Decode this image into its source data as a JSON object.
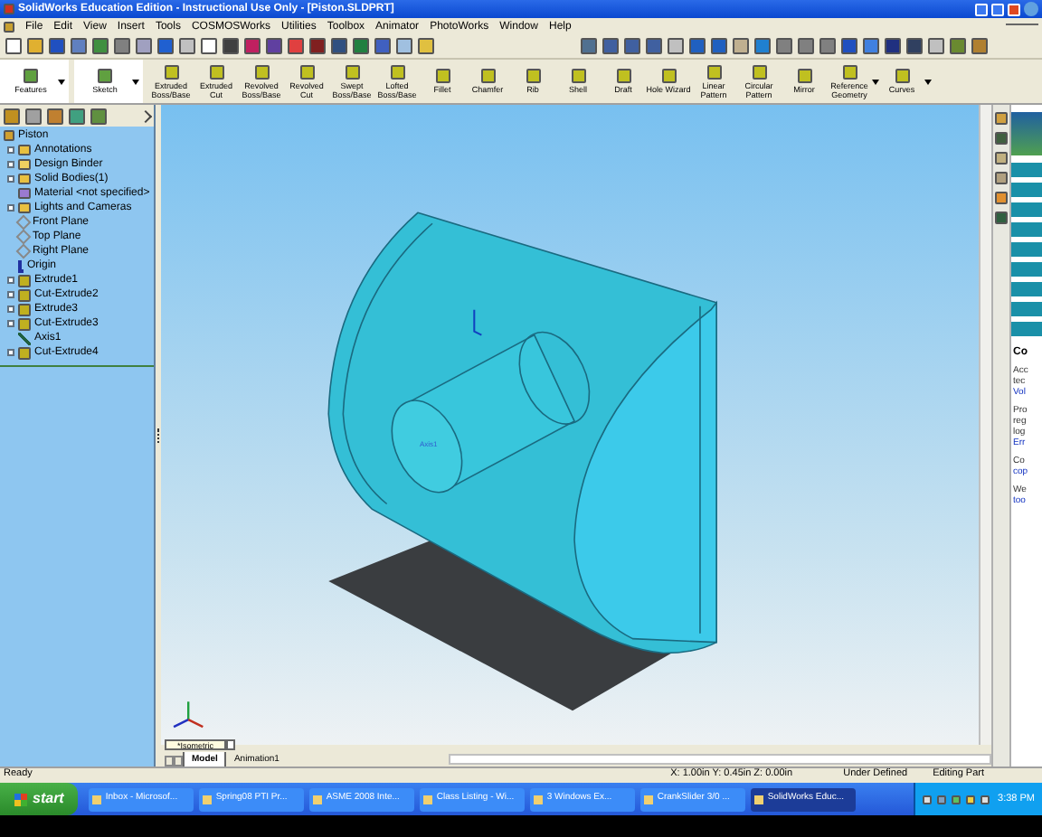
{
  "window": {
    "title": "SolidWorks Education Edition - Instructional Use Only - [Piston.SLDPRT]"
  },
  "menu": [
    "File",
    "Edit",
    "View",
    "Insert",
    "Tools",
    "COSMOSWorks",
    "Utilities",
    "Toolbox",
    "Animator",
    "PhotoWorks",
    "Window",
    "Help"
  ],
  "feature_tools": [
    {
      "label": "Features",
      "kind": "tab",
      "dropdown": true
    },
    {
      "label": "Sketch",
      "kind": "tab",
      "dropdown": true
    },
    {
      "label": "Extruded Boss/Base",
      "kind": "tool",
      "dropdown": false
    },
    {
      "label": "Extruded Cut",
      "kind": "tool",
      "dropdown": false
    },
    {
      "label": "Revolved Boss/Base",
      "kind": "tool",
      "dropdown": false
    },
    {
      "label": "Revolved Cut",
      "kind": "tool",
      "dropdown": false
    },
    {
      "label": "Swept Boss/Base",
      "kind": "tool",
      "dropdown": false
    },
    {
      "label": "Lofted Boss/Base",
      "kind": "tool",
      "dropdown": false
    },
    {
      "label": "Fillet",
      "kind": "tool",
      "dropdown": false
    },
    {
      "label": "Chamfer",
      "kind": "tool",
      "dropdown": false
    },
    {
      "label": "Rib",
      "kind": "tool",
      "dropdown": false
    },
    {
      "label": "Shell",
      "kind": "tool",
      "dropdown": false
    },
    {
      "label": "Draft",
      "kind": "tool",
      "dropdown": false
    },
    {
      "label": "Hole Wizard",
      "kind": "tool",
      "dropdown": false
    },
    {
      "label": "Linear Pattern",
      "kind": "tool",
      "dropdown": false
    },
    {
      "label": "Circular Pattern",
      "kind": "tool",
      "dropdown": false
    },
    {
      "label": "Mirror",
      "kind": "tool",
      "dropdown": false
    },
    {
      "label": "Reference Geometry",
      "kind": "tool",
      "dropdown": true
    },
    {
      "label": "Curves",
      "kind": "tool",
      "dropdown": true
    }
  ],
  "feature_tree": {
    "label": "Piston",
    "children": [
      {
        "label": "Annotations",
        "kind": "folder",
        "expandable": true
      },
      {
        "label": "Design Binder",
        "kind": "binder",
        "expandable": true
      },
      {
        "label": "Solid Bodies(1)",
        "kind": "folder",
        "expandable": true
      },
      {
        "label": "Material <not specified>",
        "kind": "material",
        "expandable": false
      },
      {
        "label": "Lights and Cameras",
        "kind": "folder",
        "expandable": true
      },
      {
        "label": "Front Plane",
        "kind": "plane",
        "expandable": false
      },
      {
        "label": "Top Plane",
        "kind": "plane",
        "expandable": false
      },
      {
        "label": "Right Plane",
        "kind": "plane",
        "expandable": false
      },
      {
        "label": "Origin",
        "kind": "origin",
        "expandable": false
      },
      {
        "label": "Extrude1",
        "kind": "feature",
        "expandable": true
      },
      {
        "label": "Cut-Extrude2",
        "kind": "feature",
        "expandable": true
      },
      {
        "label": "Extrude3",
        "kind": "feature",
        "expandable": true
      },
      {
        "label": "Cut-Extrude3",
        "kind": "feature",
        "expandable": true
      },
      {
        "label": "Axis1",
        "kind": "axis",
        "expandable": false
      },
      {
        "label": "Cut-Extrude4",
        "kind": "feature",
        "expandable": true
      }
    ]
  },
  "viewport": {
    "axis_label": "Axis1",
    "view": "*Isometric"
  },
  "view_tabs": [
    {
      "label": "Model",
      "selected": true
    },
    {
      "label": "Animation1",
      "selected": false
    }
  ],
  "task_pane": {
    "heading": "Co",
    "lines": [
      {
        "text": "Acc",
        "link": false
      },
      {
        "text": "tec",
        "link": false
      },
      {
        "text": "Vol",
        "link": true
      },
      {
        "text": "Pro",
        "link": false
      },
      {
        "text": "reg",
        "link": false
      },
      {
        "text": "log",
        "link": false
      },
      {
        "text": "Err",
        "link": true
      },
      {
        "text": "Co",
        "link": false
      },
      {
        "text": "cop",
        "link": true
      },
      {
        "text": "We",
        "link": false
      },
      {
        "text": "too",
        "link": true
      }
    ]
  },
  "status_bar": {
    "message": "Ready",
    "coordinates": "X: 1.00in Y: 0.45in Z: 0.00in",
    "sketch_state": "Under Defined",
    "mode": "Editing Part"
  },
  "taskbar": {
    "start": "start",
    "items": [
      {
        "label": "Inbox - Microsof...",
        "selected": false
      },
      {
        "label": "Spring08 PTI Pr...",
        "selected": false
      },
      {
        "label": "ASME 2008 Inte...",
        "selected": false
      },
      {
        "label": "Class Listing - Wi...",
        "selected": false
      },
      {
        "label": "3 Windows Ex...",
        "selected": false
      },
      {
        "label": "CrankSlider 3/0 ...",
        "selected": false
      },
      {
        "label": "SolidWorks Educ...",
        "selected": true
      }
    ],
    "clock": "3:38 PM"
  }
}
